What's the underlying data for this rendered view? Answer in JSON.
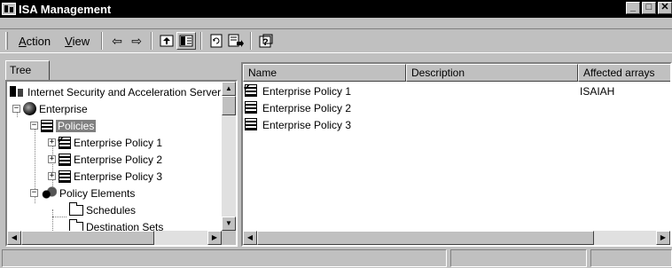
{
  "window": {
    "title": "ISA Management"
  },
  "window_buttons": {
    "minimize": "_",
    "maximize": "□",
    "close": "✕"
  },
  "menu": {
    "action": {
      "accel": "A",
      "rest": "ction"
    },
    "view": {
      "accel": "V",
      "rest": "iew"
    }
  },
  "toolbar_icons": [
    "back-arrow",
    "forward-arrow",
    "up-folder",
    "show-hide-tree",
    "refresh",
    "export-list",
    "help"
  ],
  "tree_tab": "Tree",
  "tree": [
    {
      "label": "Internet Security and Acceleration Server",
      "icon": "server-icon",
      "level": 0
    },
    {
      "label": "Enterprise",
      "icon": "globe-icon",
      "level": 1,
      "expander": "−"
    },
    {
      "label": "Policies",
      "icon": "policy-icon",
      "level": 2,
      "expander": "−",
      "selected": true
    },
    {
      "label": "Enterprise Policy 1",
      "icon": "policy-checked-icon",
      "level": 3,
      "expander": "+"
    },
    {
      "label": "Enterprise Policy 2",
      "icon": "policy-icon",
      "level": 3,
      "expander": "+"
    },
    {
      "label": "Enterprise Policy 3",
      "icon": "policy-icon",
      "level": 3,
      "expander": "+"
    },
    {
      "label": "Policy Elements",
      "icon": "elements-icon",
      "level": 2,
      "expander": "−"
    },
    {
      "label": "Schedules",
      "icon": "folder-icon",
      "level": 3
    },
    {
      "label": "Destination Sets",
      "icon": "folder-icon",
      "level": 3
    }
  ],
  "list": {
    "columns": [
      "Name",
      "Description",
      "Affected arrays"
    ],
    "rows": [
      {
        "name": "Enterprise Policy 1",
        "description": "",
        "arrays": "ISAIAH",
        "icon": "policy-checked-icon"
      },
      {
        "name": "Enterprise Policy 2",
        "description": "",
        "arrays": "",
        "icon": "policy-icon"
      },
      {
        "name": "Enterprise Policy 3",
        "description": "",
        "arrays": "",
        "icon": "policy-icon"
      }
    ]
  },
  "scroll_glyphs": {
    "up": "▲",
    "down": "▼",
    "left": "◀",
    "right": "▶"
  }
}
